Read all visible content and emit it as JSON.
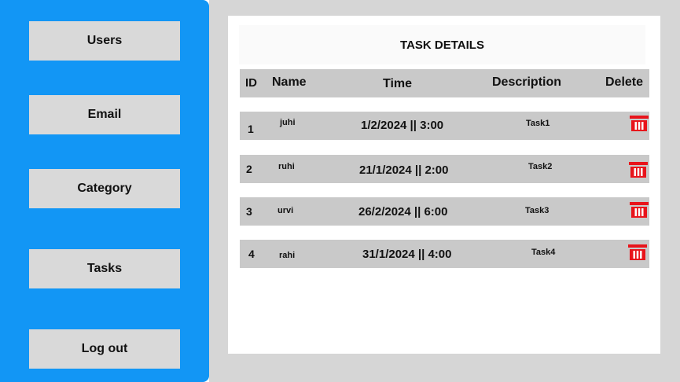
{
  "sidebar": {
    "items": [
      {
        "label": "Users"
      },
      {
        "label": "Email"
      },
      {
        "label": "Category"
      },
      {
        "label": "Tasks"
      },
      {
        "label": "Log out"
      }
    ]
  },
  "main": {
    "title": "TASK DETAILS",
    "columns": {
      "id": "ID",
      "name": "Name",
      "time": "Time",
      "description": "Description",
      "delete": "Delete"
    },
    "rows": [
      {
        "id": "1",
        "name": "juhi",
        "time": "1/2/2024 || 3:00",
        "description": "Task1"
      },
      {
        "id": "2",
        "name": "ruhi",
        "time": "21/1/2024 || 2:00",
        "description": "Task2"
      },
      {
        "id": "3",
        "name": "urvi",
        "time": "26/2/2024 || 6:00",
        "description": "Task3"
      },
      {
        "id": "4",
        "name": "rahi",
        "time": "31/1/2024 || 4:00",
        "description": "Task4"
      }
    ]
  },
  "colors": {
    "sidebar": "#1296f5",
    "delete_icon": "#e8141b"
  }
}
